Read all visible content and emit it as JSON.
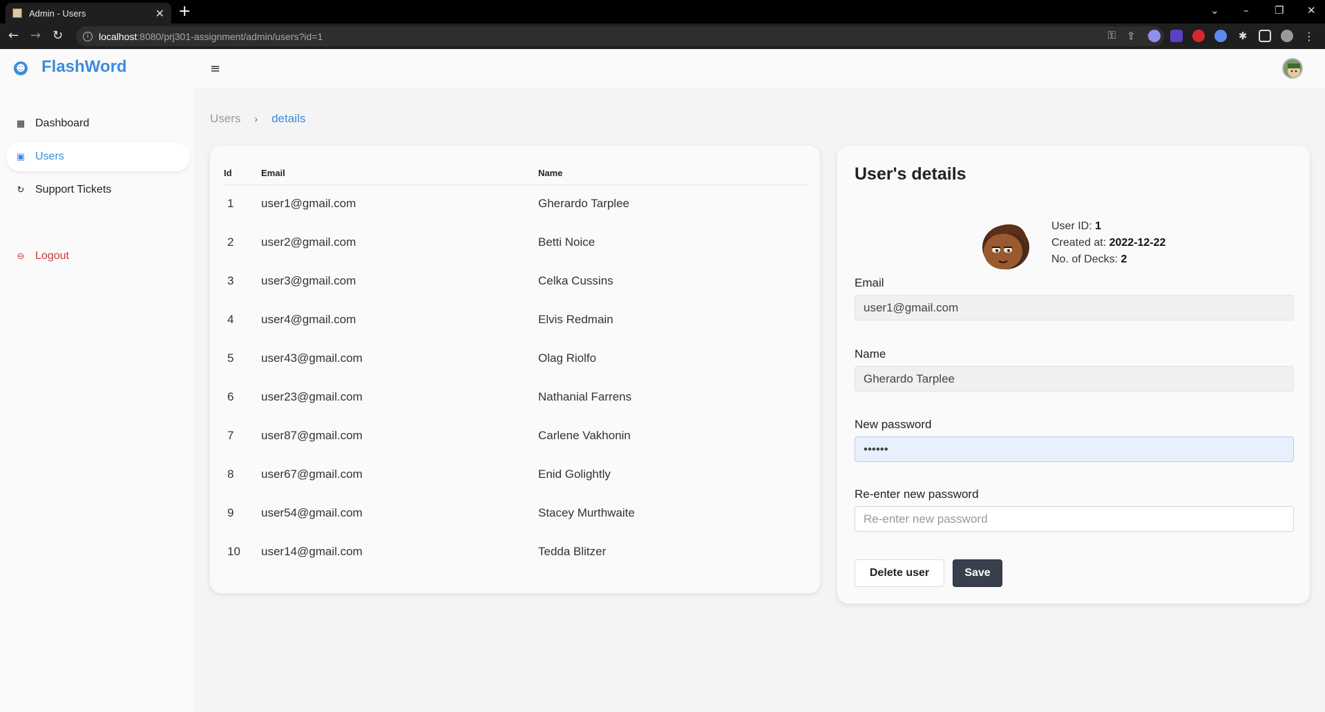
{
  "browser": {
    "tab_title": "Admin - Users",
    "url_host": "localhost",
    "url_path": ":8080/prj301-assignment/admin/users?id=1"
  },
  "app": {
    "brand": "FlashWord"
  },
  "sidebar": {
    "items": [
      {
        "label": "Dashboard",
        "icon": "grid-icon"
      },
      {
        "label": "Users",
        "icon": "user-card-icon"
      },
      {
        "label": "Support Tickets",
        "icon": "refresh-icon"
      }
    ],
    "logout_label": "Logout"
  },
  "breadcrumb": {
    "parent": "Users",
    "separator": "›",
    "current": "details"
  },
  "users_table": {
    "headers": [
      "Id",
      "Email",
      "Name"
    ],
    "rows": [
      {
        "id": "1",
        "email": "user1@gmail.com",
        "name": "Gherardo Tarplee"
      },
      {
        "id": "2",
        "email": "user2@gmail.com",
        "name": "Betti Noice"
      },
      {
        "id": "3",
        "email": "user3@gmail.com",
        "name": "Celka Cussins"
      },
      {
        "id": "4",
        "email": "user4@gmail.com",
        "name": "Elvis Redmain"
      },
      {
        "id": "5",
        "email": "user43@gmail.com",
        "name": "Olag Riolfo"
      },
      {
        "id": "6",
        "email": "user23@gmail.com",
        "name": "Nathanial Farrens"
      },
      {
        "id": "7",
        "email": "user87@gmail.com",
        "name": "Carlene Vakhonin"
      },
      {
        "id": "8",
        "email": "user67@gmail.com",
        "name": "Enid Golightly"
      },
      {
        "id": "9",
        "email": "user54@gmail.com",
        "name": "Stacey Murthwaite"
      },
      {
        "id": "10",
        "email": "user14@gmail.com",
        "name": "Tedda Blitzer"
      }
    ]
  },
  "details": {
    "title": "User's details",
    "user_id_label": "User ID:",
    "user_id": "1",
    "created_label": "Created at:",
    "created_at": "2022-12-22",
    "decks_label": "No. of Decks:",
    "decks": "2",
    "email_label": "Email",
    "email_value": "user1@gmail.com",
    "name_label": "Name",
    "name_value": "Gherardo Tarplee",
    "new_password_label": "New password",
    "new_password_value": "••••••",
    "reenter_label": "Re-enter new password",
    "reenter_placeholder": "Re-enter new password",
    "delete_label": "Delete user",
    "save_label": "Save"
  },
  "colors": {
    "accent": "#3d8bdb",
    "logout": "#d0393b",
    "save_button": "#3a3f4d"
  }
}
